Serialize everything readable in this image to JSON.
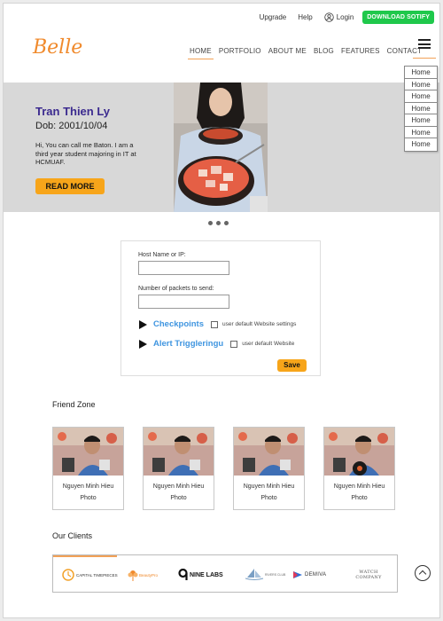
{
  "topbar": {
    "upgrade": "Upgrade",
    "help": "Help",
    "login": "Login",
    "download": "DOWNLOAD SOTIFY"
  },
  "logo": {
    "text": "Belle",
    "color": "#f08a2c"
  },
  "nav": {
    "items": [
      "HOME",
      "PORTFOLIO",
      "ABOUT ME",
      "BLOG",
      "FEATURES",
      "CONTACT"
    ],
    "active": "HOME"
  },
  "dropdown": {
    "items": [
      "Home",
      "Home",
      "Home",
      "Home",
      "Home",
      "Home",
      "Home"
    ]
  },
  "hero": {
    "name": "Tran Thien Ly",
    "dob": "Dob: 2001/10/04",
    "bio": "Hi, You can call me Baton. I am a third year student majoring in IT at HCMUAF.",
    "cta": "READ MORE"
  },
  "form": {
    "host_label": "Host Name or IP:",
    "host_value": "",
    "packets_label": "Number of packets to send:",
    "packets_value": "",
    "checkpoints": "Checkpoints",
    "checkpoints_option": "user default Website settings",
    "alert": "Alert Triggleringu",
    "alert_option": "user default Website",
    "save": "Save"
  },
  "friends": {
    "title": "Friend Zone",
    "cards": [
      {
        "name": "Nguyen Minh Hieu",
        "caption": "Photo"
      },
      {
        "name": "Nguyen Minh Hieu",
        "caption": "Photo"
      },
      {
        "name": "Nguyen Minh Hieu",
        "caption": "Photo"
      },
      {
        "name": "Nguyen Minh Hieu",
        "caption": "Photo"
      }
    ]
  },
  "clients": {
    "title": "Our Clients",
    "logos": [
      "CAPITAL TIMEPIECES",
      "BeautyPro",
      "NINE LABS",
      "RIVERS CLUB",
      "DEMIVA",
      "WATCH COMPANY"
    ]
  },
  "colors": {
    "accent": "#f7a51a",
    "green": "#1fc84b",
    "link": "#3f95e0",
    "name": "#3b2a8f"
  }
}
